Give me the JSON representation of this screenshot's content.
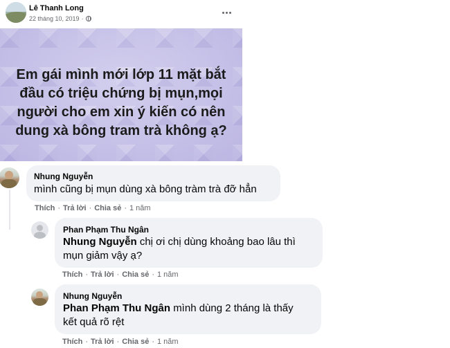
{
  "post": {
    "author": "Lê Thanh Long",
    "date": "22 tháng 10, 2019",
    "privacy_separator": "·",
    "image_text": "Em gái mình mới lớp 11 mặt bắt đầu có triệu chứng bị mụn,mọi người cho em xin ý kiến có nên dung xà bông tram trà không ạ?",
    "more_icon": "more-horizontal-icon",
    "image_color": "#c9c4ea"
  },
  "actions": {
    "like": "Thích",
    "reply": "Trả lời",
    "share": "Chia sẻ",
    "separator": "·"
  },
  "comments": [
    {
      "author": "Nhung Nguyễn",
      "mention": "",
      "text": "mình cũng bị mụn dùng xà bông tràm trà đỡ hẳn",
      "time": "1 năm"
    },
    {
      "author": "Phan Phạm Thu Ngân",
      "mention": "Nhung Nguyễn",
      "text": "chị ơi chị dùng khoảng bao lâu thì mụn giảm vậy ạ?",
      "time": "1 năm"
    },
    {
      "author": "Nhung Nguyễn",
      "mention": "Phan Phạm Thu Ngân",
      "text": "mình dùng 2 tháng là thấy kết quả rõ rệt",
      "time": "1 năm"
    }
  ]
}
